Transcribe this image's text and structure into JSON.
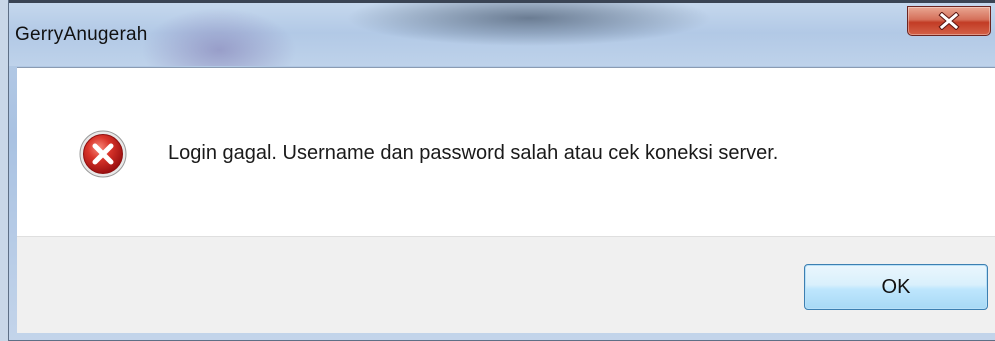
{
  "window": {
    "title": "GerryAnugerah",
    "close_icon": "close-x-icon"
  },
  "dialog": {
    "icon": "error-icon",
    "message": "Login gagal. Username dan password salah atau cek koneksi server.",
    "ok_label": "OK"
  },
  "colors": {
    "close_button": "#c23c25",
    "error_icon": "#c81e1e",
    "ok_button_border": "#3c7fb1",
    "button_area": "#f0f0f0"
  }
}
